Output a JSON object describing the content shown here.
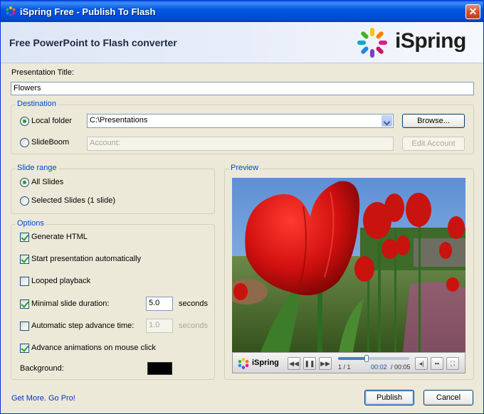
{
  "window": {
    "title": "iSpring Free - Publish To Flash",
    "close_label": "✕"
  },
  "banner": {
    "heading": "Free PowerPoint to Flash converter",
    "logo_text": "iSpring"
  },
  "presentation_title": {
    "label": "Presentation Title:",
    "value": "Flowers"
  },
  "destination": {
    "title": "Destination",
    "local_folder_label": "Local folder",
    "local_folder_value": "C:\\Presentations",
    "browse_label": "Browse...",
    "slideboom_label": "SlideBoom",
    "account_placeholder": "Account:",
    "edit_account_label": "Edit Account",
    "selected": "local"
  },
  "slide_range": {
    "title": "Slide range",
    "all_label": "All Slides",
    "selected_label": "Selected Slides (1 slide)",
    "selected": "all"
  },
  "options": {
    "title": "Options",
    "generate_html": {
      "label": "Generate HTML",
      "checked": true
    },
    "start_auto": {
      "label": "Start presentation automatically",
      "checked": true
    },
    "looped": {
      "label": "Looped playback",
      "checked": false
    },
    "min_duration": {
      "label": "Minimal slide duration:",
      "checked": true,
      "value": "5.0",
      "unit": "seconds"
    },
    "auto_step": {
      "label": "Automatic step advance time:",
      "checked": false,
      "value": "1.0",
      "unit": "seconds"
    },
    "advance_click": {
      "label": "Advance animations on mouse click",
      "checked": true
    },
    "background": {
      "label": "Background:",
      "color": "#000000"
    }
  },
  "preview": {
    "title": "Preview",
    "player_logo": "iSpring",
    "slide_counter": "1 / 1",
    "time_current": "00:02",
    "time_total": "/ 00:05",
    "progress": 0.4
  },
  "footer": {
    "link": "Get More. Go Pro!",
    "publish_label": "Publish",
    "cancel_label": "Cancel"
  },
  "colors": {
    "accent": "#0046d5",
    "titlebar": "#0358e0",
    "check": "#21a121"
  }
}
